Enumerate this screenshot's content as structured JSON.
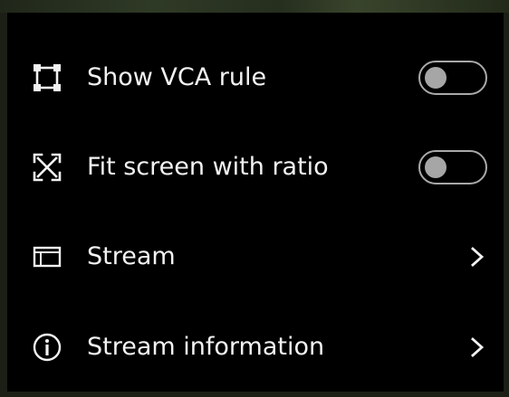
{
  "menu": {
    "items": [
      {
        "label": "Show VCA rule",
        "icon": "vca-rule-icon",
        "control": "toggle",
        "enabled": false
      },
      {
        "label": "Fit screen with ratio",
        "icon": "fit-screen-icon",
        "control": "toggle",
        "enabled": false
      },
      {
        "label": "Stream",
        "icon": "stream-icon",
        "control": "chevron"
      },
      {
        "label": "Stream information",
        "icon": "info-icon",
        "control": "chevron"
      }
    ]
  },
  "colors": {
    "background": "#000000",
    "text": "#f2f2f2",
    "toggle_off": "#a6a6a6"
  }
}
